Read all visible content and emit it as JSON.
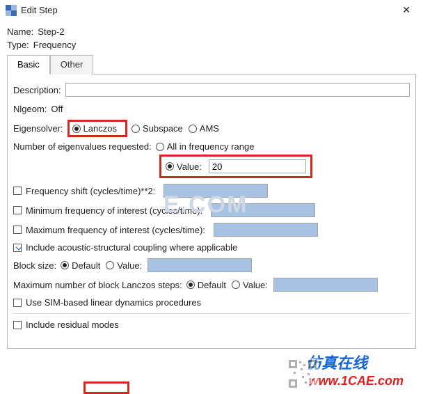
{
  "window": {
    "title": "Edit Step",
    "close_glyph": "✕"
  },
  "header": {
    "name_label": "Name:",
    "name_value": "Step-2",
    "type_label": "Type:",
    "type_value": "Frequency"
  },
  "tabs": {
    "basic": "Basic",
    "other": "Other",
    "active": "basic"
  },
  "basic": {
    "description_label": "Description:",
    "description_value": "",
    "nlgeom_label": "Nlgeom:",
    "nlgeom_value": "Off",
    "eigensolver_label": "Eigensolver:",
    "eigensolver_options": {
      "lanczos": "Lanczos",
      "subspace": "Subspace",
      "ams": "AMS"
    },
    "eigensolver_selected": "lanczos",
    "num_eig_label": "Number of eigenvalues requested:",
    "num_eig_options": {
      "all": "All in frequency range",
      "value": "Value:"
    },
    "num_eig_selected": "value",
    "num_eig_value": "20",
    "freq_shift_label": "Frequency shift (cycles/time)**2:",
    "freq_shift_checked": false,
    "min_freq_label": "Minimum frequency of interest (cycles/time):",
    "min_freq_checked": false,
    "max_freq_label": "Maximum frequency of interest (cycles/time):",
    "max_freq_checked": false,
    "acoustic_label": "Include acoustic-structural coupling where applicable",
    "acoustic_checked": true,
    "block_size_label": "Block size:",
    "block_size_options": {
      "default": "Default",
      "value": "Value:"
    },
    "block_size_selected": "default",
    "max_block_label": "Maximum number of block Lanczos steps:",
    "max_block_options": {
      "default": "Default",
      "value": "Value:"
    },
    "max_block_selected": "default",
    "sim_label": "Use SIM-based linear dynamics procedures",
    "sim_checked": false,
    "residual_label": "Include residual modes",
    "residual_checked": false
  },
  "decor": {
    "watermark": "E.COM",
    "footer_cn": "仿真在线",
    "footer_url": "www.1CAE.com"
  }
}
